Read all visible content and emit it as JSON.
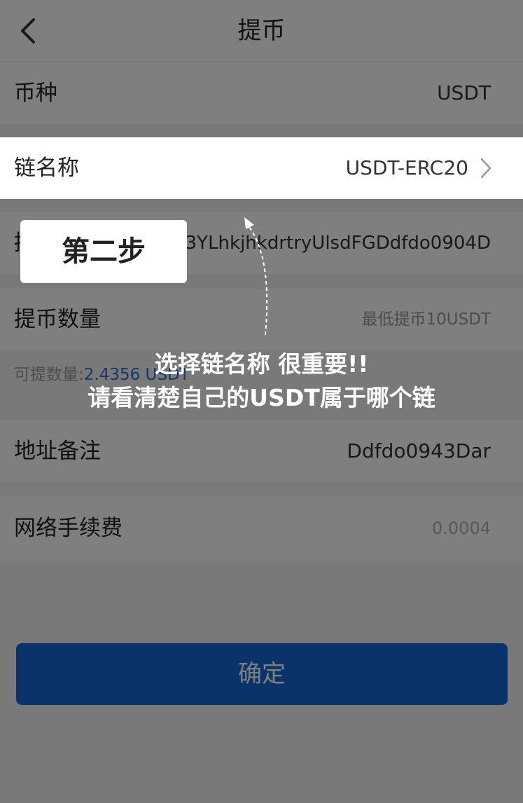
{
  "header": {
    "title": "提币",
    "back_icon": "chevron-left-icon"
  },
  "currency": {
    "label": "币种",
    "value": "USDT"
  },
  "chain": {
    "label": "链名称",
    "value": "USDT-ERC20",
    "icon": "chevron-right-icon"
  },
  "address": {
    "label": "提",
    "value": "3YLhkjhkdrtryUlsdFGDdfdo0904D"
  },
  "amount": {
    "label": "提币数量",
    "placeholder": "最低提币10USDT"
  },
  "available": {
    "prefix": "可提数量:",
    "value": "2.4356 USDT"
  },
  "memo": {
    "label": "地址备注",
    "value": "Ddfdo0943Dar"
  },
  "fee": {
    "label": "网络手续费",
    "value": "0.0004"
  },
  "confirm": {
    "label": "确定"
  },
  "guide": {
    "step": "第二步",
    "line1": "选择链名称 很重要!!",
    "line2": "请看清楚自己的USDT属于哪个链"
  },
  "colors": {
    "primary": "#1467d8",
    "link": "#2f6fd0",
    "overlay": "rgba(0,0,0,0.5)"
  }
}
